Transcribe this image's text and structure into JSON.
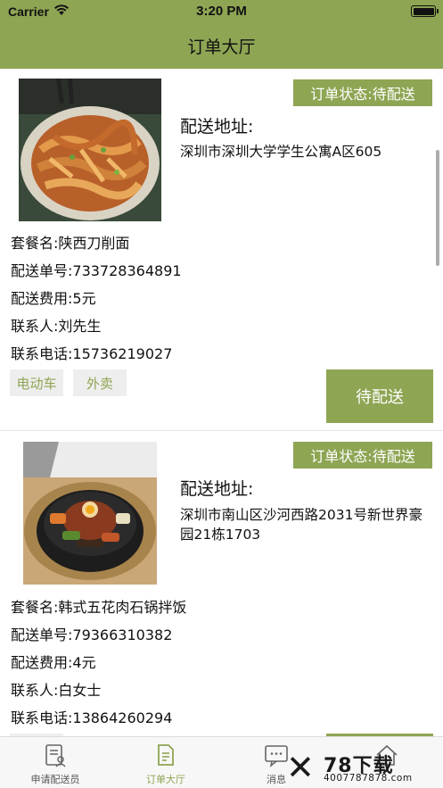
{
  "status_bar": {
    "carrier": "Carrier",
    "time": "3:20 PM"
  },
  "nav": {
    "title": "订单大厅"
  },
  "theme": {
    "accent": "#8ea553",
    "tag_bg": "#eeeeee"
  },
  "orders": [
    {
      "image_icon": "noodle-dish-photo",
      "status": "订单状态:待配送",
      "address_label": "配送地址:",
      "address": "深圳市深圳大学学生公寓A区605",
      "package": "套餐名:陕西刀削面",
      "order_no": "配送单号:733728364891",
      "fee": "配送费用:5元",
      "contact": "联系人:刘先生",
      "phone": "联系电话:15736219027",
      "tags": [
        "电动车",
        "外卖"
      ],
      "action": "待配送"
    },
    {
      "image_icon": "bibimbap-dish-photo",
      "status": "订单状态:待配送",
      "address_label": "配送地址:",
      "address": "深圳市南山区沙河西路2031号新世界豪园21栋1703",
      "package": "套餐名:韩式五花肉石锅拌饭",
      "order_no": "配送单号:79366310382",
      "fee": "配送费用:4元",
      "contact": "联系人:白女士",
      "phone": "联系电话:13864260294"
    }
  ],
  "tabbar": {
    "items": [
      {
        "label": "申请配送员",
        "icon": "apply-form-icon"
      },
      {
        "label": "订单大厅",
        "icon": "order-document-icon"
      },
      {
        "label": "消息",
        "icon": "message-icon"
      },
      {
        "label": "",
        "icon": "home-icon"
      }
    ],
    "active_index": 1
  },
  "watermark": {
    "brand": "78下载",
    "sub": "4007787878.com"
  }
}
